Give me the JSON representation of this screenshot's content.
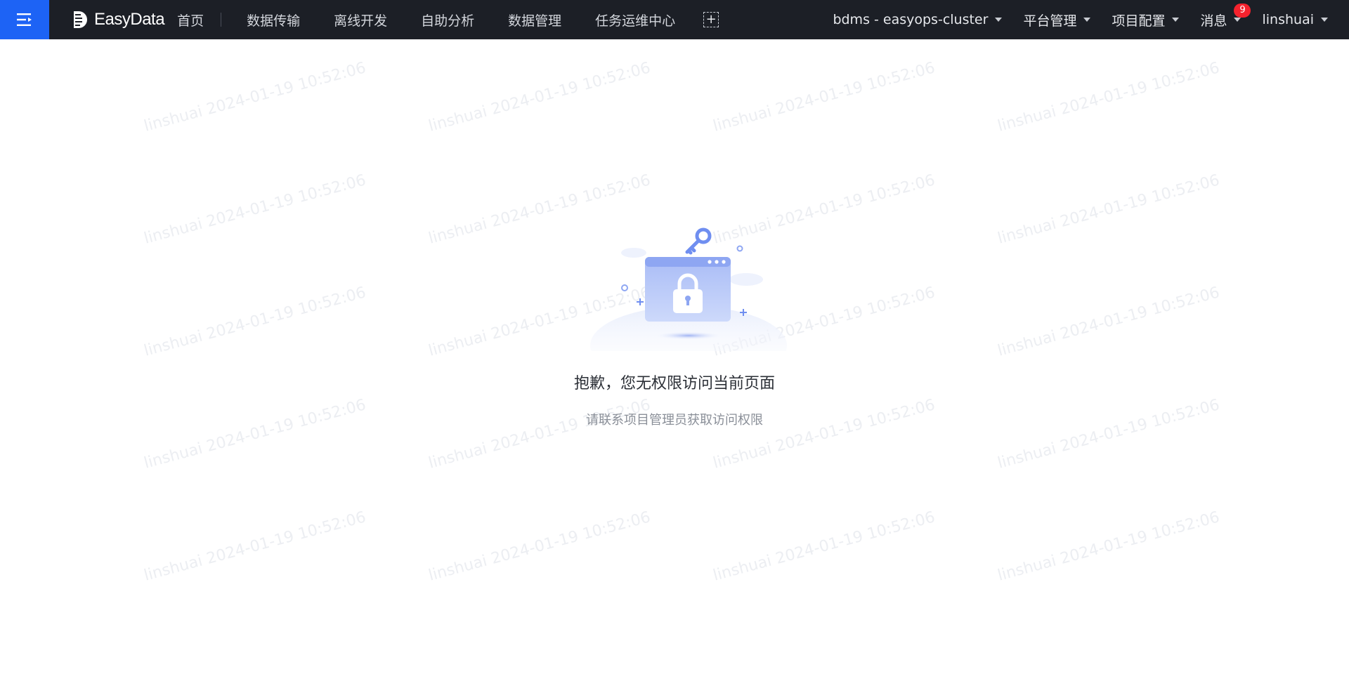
{
  "header": {
    "brand": "EasyData",
    "home": "首页",
    "nav": [
      "数据传输",
      "离线开发",
      "自助分析",
      "数据管理",
      "任务运维中心"
    ],
    "add_symbol": "+",
    "cluster": "bdms - easyops-cluster",
    "platform": "平台管理",
    "project_config": "项目配置",
    "messages": "消息",
    "message_count": "9",
    "user": "linshuai"
  },
  "watermark": "linshuai 2024-01-19 10:52:06",
  "empty": {
    "title": "抱歉，您无权限访问当前页面",
    "subtitle": "请联系项目管理员获取访问权限"
  },
  "colors": {
    "topbar": "#1c1f26",
    "accent": "#1d63f5",
    "badge": "#f5222d"
  }
}
